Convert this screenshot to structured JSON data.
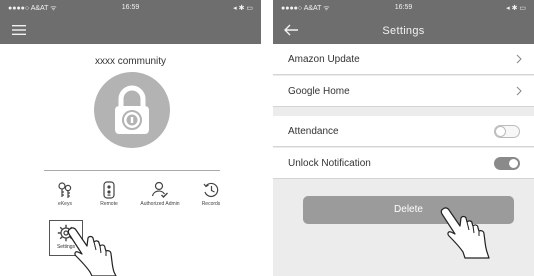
{
  "left_screen": {
    "status": {
      "carrier": "●●●●○ A&AT ᯤ",
      "time": "16:59",
      "right": "◂ ✱ ▭"
    },
    "community_name": "xxxx community",
    "functions": [
      {
        "label": "eKeys",
        "icon": "ekeys-icon"
      },
      {
        "label": "Remote",
        "icon": "remote-icon"
      },
      {
        "label": "Authorized Admin",
        "icon": "authorized-admin-icon"
      },
      {
        "label": "Records",
        "icon": "records-icon"
      }
    ],
    "settings": {
      "label": "Settings",
      "icon": "gear-icon"
    }
  },
  "right_screen": {
    "status": {
      "carrier": "●●●●○ A&AT ᯤ",
      "time": "16:59",
      "right": "◂ ✱ ▭"
    },
    "title": "Settings",
    "rows": [
      {
        "label": "Amazon Update",
        "type": "chevron"
      },
      {
        "label": "Google  Home",
        "type": "chevron"
      },
      {
        "label": "Attendance",
        "type": "toggle",
        "on": false
      },
      {
        "label": "Unlock Notification",
        "type": "toggle",
        "on": true
      }
    ],
    "delete_label": "Delete"
  },
  "colors": {
    "bar": "#6e6e6e",
    "lock_circle": "#b3b3b3",
    "delete_button": "#9b9b9b"
  }
}
